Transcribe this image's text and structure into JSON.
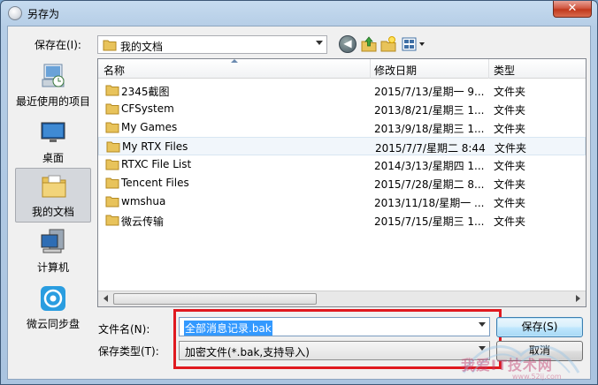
{
  "window": {
    "title": "另存为",
    "close": "✕"
  },
  "toolbar": {
    "save_in_label": "保存在(I):",
    "save_in_value": "我的文档"
  },
  "places": [
    {
      "label": "最近使用的项目"
    },
    {
      "label": "桌面"
    },
    {
      "label": "我的文档"
    },
    {
      "label": "计算机"
    },
    {
      "label": "微云同步盘"
    }
  ],
  "columns": {
    "name": "名称",
    "date": "修改日期",
    "type": "类型"
  },
  "files": [
    {
      "name": "2345截图",
      "date": "2015/7/13/星期一 9...",
      "type": "文件夹"
    },
    {
      "name": "CFSystem",
      "date": "2013/8/21/星期三 1...",
      "type": "文件夹"
    },
    {
      "name": "My Games",
      "date": "2013/9/18/星期三 1...",
      "type": "文件夹"
    },
    {
      "name": "My RTX Files",
      "date": "2015/7/7/星期二 8:44",
      "type": "文件夹"
    },
    {
      "name": "RTXC File List",
      "date": "2014/3/13/星期四 1...",
      "type": "文件夹"
    },
    {
      "name": "Tencent Files",
      "date": "2015/7/28/星期二 8...",
      "type": "文件夹"
    },
    {
      "name": "wmshua",
      "date": "2013/11/18/星期一 ...",
      "type": "文件夹"
    },
    {
      "name": "微云传输",
      "date": "2015/7/15/星期三 1...",
      "type": "文件夹"
    }
  ],
  "form": {
    "filename_label": "文件名(N):",
    "filename_value": "全部消息记录.bak",
    "filetype_label": "保存类型(T):",
    "filetype_value": "加密文件(*.bak,支持导入)",
    "save_button": "保存(S)",
    "cancel_button": "取消"
  },
  "watermark": {
    "text": "我爱IT技术网",
    "url": "www.52ij.com"
  },
  "colors": {
    "accent": "#3399ff",
    "highlight_box": "#e0191f"
  }
}
